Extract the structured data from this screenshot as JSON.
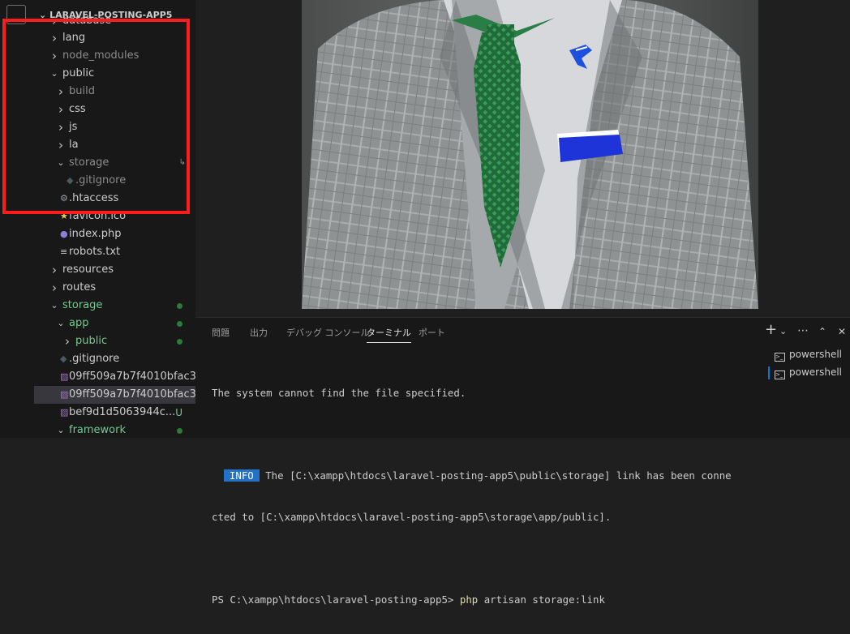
{
  "explorer": {
    "project_title": "LARAVEL-POSTING-APP5",
    "items": [
      {
        "label": "database",
        "type": "folder",
        "open": false
      },
      {
        "label": "lang",
        "type": "folder",
        "open": false
      },
      {
        "label": "node_modules",
        "type": "folder",
        "open": false,
        "dim": true
      },
      {
        "label": "public",
        "type": "folder",
        "open": true
      },
      {
        "label": "build",
        "type": "folder",
        "open": false,
        "dim": true
      },
      {
        "label": "css",
        "type": "folder",
        "open": false
      },
      {
        "label": "js",
        "type": "folder",
        "open": false
      },
      {
        "label": "la",
        "type": "folder",
        "open": false
      },
      {
        "label": "storage",
        "type": "folder",
        "open": true,
        "dim": true,
        "symlink_glyph": "↳"
      },
      {
        "label": ".gitignore",
        "type": "file",
        "dim": true
      },
      {
        "label": ".htaccess",
        "type": "file"
      },
      {
        "label": "favicon.ico",
        "type": "file"
      },
      {
        "label": "index.php",
        "type": "file"
      },
      {
        "label": "robots.txt",
        "type": "file"
      },
      {
        "label": "resources",
        "type": "folder",
        "open": false
      },
      {
        "label": "routes",
        "type": "folder",
        "open": false
      },
      {
        "label": "storage",
        "type": "folder",
        "open": true,
        "modified": true
      },
      {
        "label": "app",
        "type": "folder",
        "open": true,
        "modified": true
      },
      {
        "label": "public",
        "type": "folder",
        "open": false,
        "modified": true
      },
      {
        "label": ".gitignore",
        "type": "file"
      },
      {
        "label": "09ff509a7b7f4010bfac3...",
        "type": "image"
      },
      {
        "label": "09ff509a7b7f4010bfac3...",
        "type": "image",
        "selected": true
      },
      {
        "label": "bef9d1d5063944c...",
        "type": "image",
        "status": "U"
      },
      {
        "label": "framework",
        "type": "folder",
        "open": true,
        "modified": true
      }
    ]
  },
  "panel": {
    "tabs": [
      {
        "label": "問題"
      },
      {
        "label": "出力"
      },
      {
        "label": "デバッグ コンソール"
      },
      {
        "label": "ターミナル",
        "active": true
      },
      {
        "label": "ポート"
      }
    ],
    "toolbar": {
      "add": "+",
      "dropdown": "⌄",
      "more": "⋯",
      "maximize": "⌃",
      "close": "✕"
    },
    "terminal": {
      "line1": "The system cannot find the file specified.",
      "info_badge": "INFO",
      "line2": " The [C:\\xampp\\htdocs\\laravel-posting-app5\\public\\storage] link has been conne",
      "line3": "cted to [C:\\xampp\\htdocs\\laravel-posting-app5\\storage\\app/public].",
      "prompt": "PS C:\\xampp\\htdocs\\laravel-posting-app5> ",
      "command_php": "php",
      "command_rest": " artisan storage:link"
    },
    "terminal_list": [
      "powershell",
      "powershell"
    ]
  },
  "colors": {
    "accent_blue": "#2472c8",
    "git_green": "#73c991",
    "highlight_red": "#ff1c1c"
  }
}
